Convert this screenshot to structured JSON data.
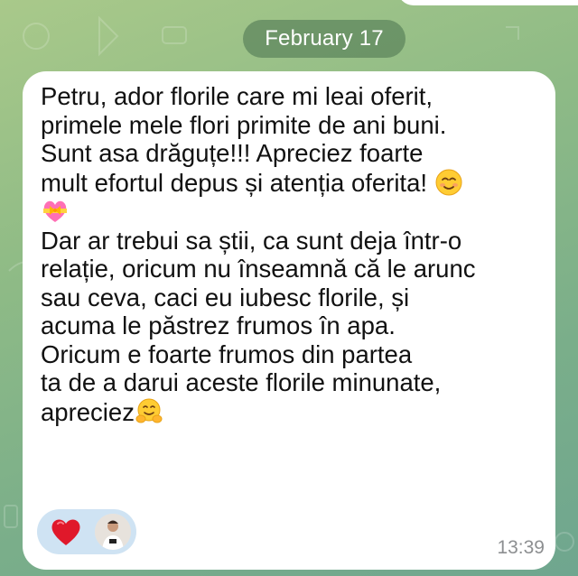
{
  "chat": {
    "date_separator": "February 17",
    "message": {
      "text": {
        "part1": "Petru, ador florile care mi leai oferit,\nprimele mele flori primite de ani buni.\nSunt asa drăguțe!!! Apreciez foarte\nmult efortul depus și atenția oferita! ",
        "part2": "\nDar ar trebui sa știi, ca sunt deja într-o\nrelație, oricum nu înseamnă că le arunc\nsau ceva, caci eu iubesc florile, și\nacuma le păstrez frumos în apa.\nOricum e foarte frumos din partea\nta de a darui aceste florile minunate,\napreciez"
      },
      "emojis": [
        "smiling-face-icon",
        "heart-with-ribbon-icon",
        "hugging-face-icon"
      ],
      "time": "13:39",
      "reaction": {
        "emoji": "red-heart-icon",
        "reactor": "avatar"
      }
    }
  },
  "colors": {
    "background_top": "#a9c98a",
    "background_bottom": "#6fa68f",
    "bubble": "#ffffff",
    "date_pill": "#5c845c",
    "reaction_pill": "#cfe3f3",
    "timestamp": "#8d8f91",
    "heart": "#e0182a"
  }
}
